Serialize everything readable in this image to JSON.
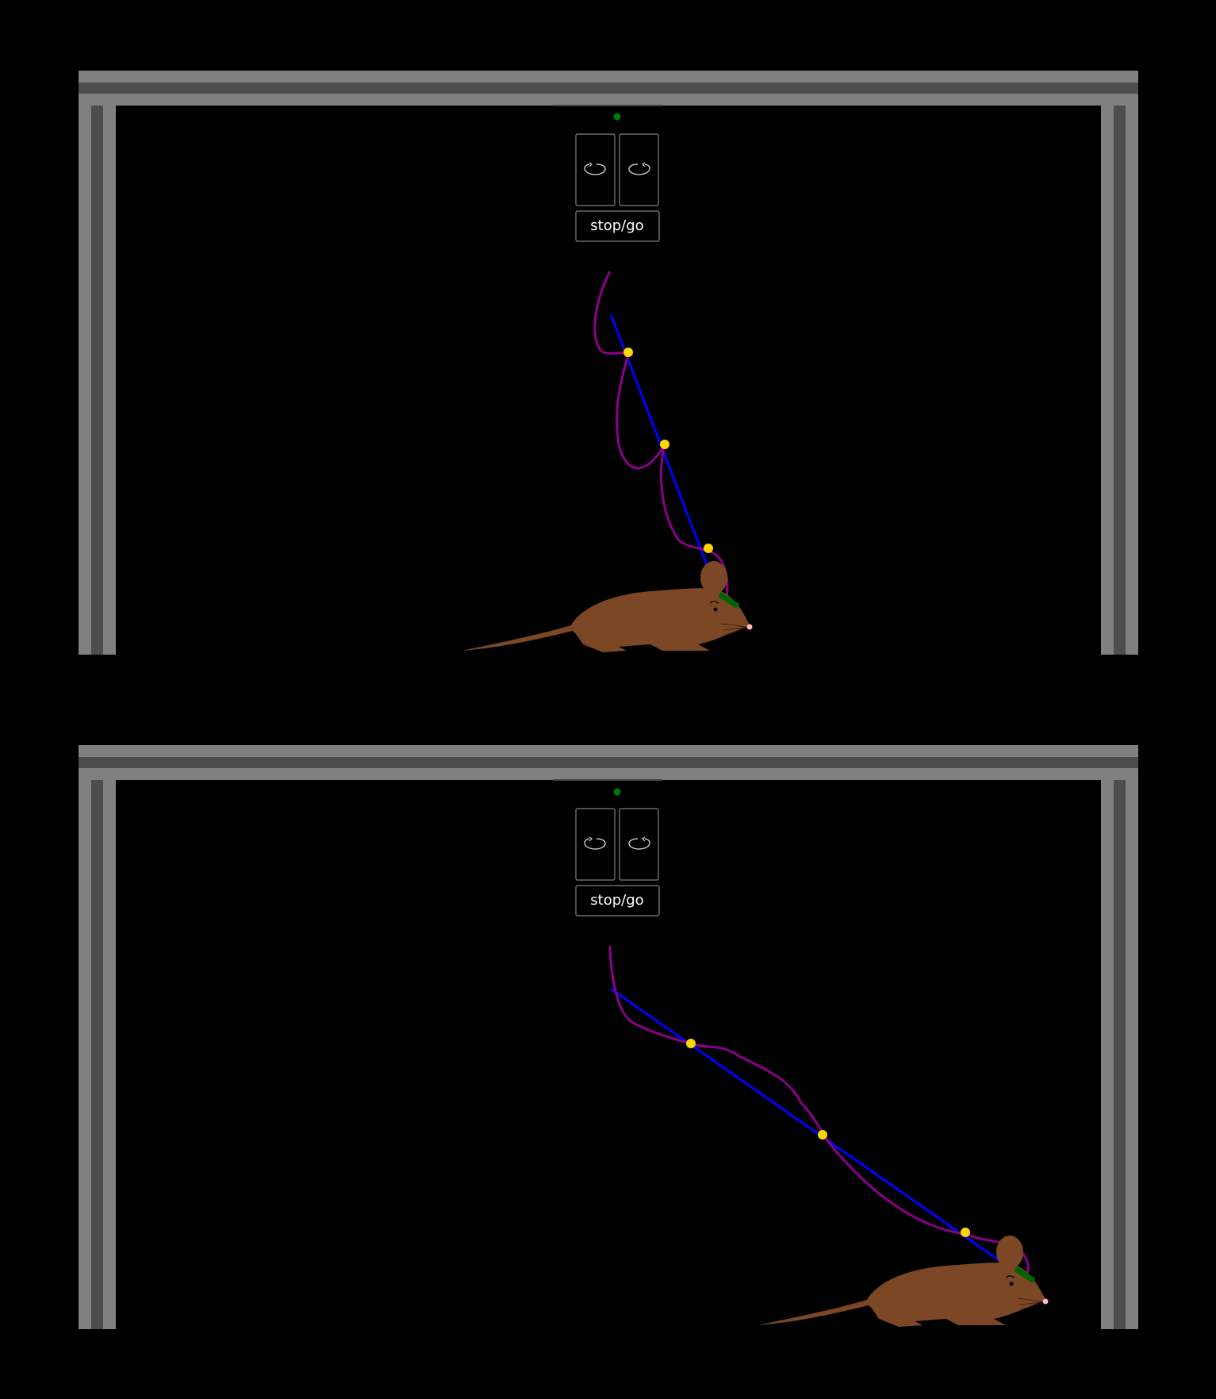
{
  "panels": [
    {
      "id": "top",
      "stop_go_label": "stop/go",
      "indicator_color": "#007a00"
    },
    {
      "id": "bottom",
      "stop_go_label": "stop/go",
      "indicator_color": "#007a00"
    }
  ],
  "colors": {
    "background": "#000000",
    "frame_light": "#808080",
    "frame_dark": "#4d4d4d",
    "tether_straight": "#0000ff",
    "tether_cable": "#8b008b",
    "clip": "#ffd700",
    "mouse_body": "#7b4725",
    "mouse_nose": "#ffb6c1",
    "headstage": "#006400",
    "panel_border": "#808080"
  },
  "icons": {
    "rotate_left": "rotate-counterclockwise-icon",
    "rotate_right": "rotate-clockwise-icon"
  }
}
